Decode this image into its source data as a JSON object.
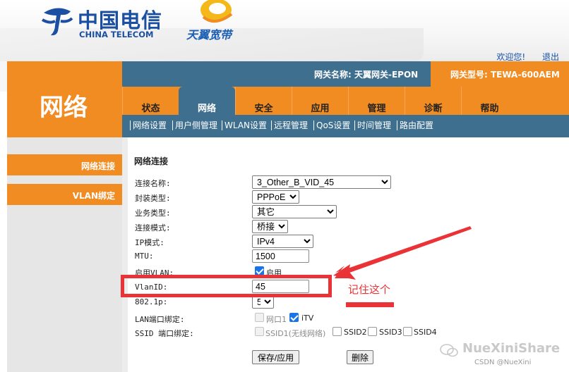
{
  "brand": {
    "logo_cn": "中国电信",
    "logo_en": "CHINA TELECOM",
    "tianyi": "天翼宽带",
    "colors": {
      "orange": "#f08c22",
      "steel_blue": "#3e6f8e",
      "logo_blue": "#1b4fa2",
      "annotation_red": "#ea3336"
    }
  },
  "top_links": {
    "welcome": "欢迎您!",
    "logout": "退出"
  },
  "section_title": "网络",
  "info_bar": {
    "gateway_name": "网关名称: 天翼网关-EPON",
    "gateway_model": "网关型号: TEWA-600AEM"
  },
  "tabs": [
    {
      "label": "状态"
    },
    {
      "label": "网络",
      "active": true
    },
    {
      "label": "安全"
    },
    {
      "label": "应用"
    },
    {
      "label": "管理"
    },
    {
      "label": "诊断"
    },
    {
      "label": "帮助"
    }
  ],
  "subnav": [
    "网络设置",
    "用户侧管理",
    "WLAN设置",
    "远程管理",
    "QoS设置",
    "时间管理",
    "路由配置"
  ],
  "sidebar": [
    {
      "label": "网络连接"
    },
    {
      "label": "VLAN绑定"
    }
  ],
  "form": {
    "title": "网络连接",
    "fields": {
      "conn_name": {
        "label": "连接名称:",
        "value": "3_Other_B_VID_45"
      },
      "encap": {
        "label": "封装类型:",
        "value": "PPPoE"
      },
      "service": {
        "label": "业务类型:",
        "value": "其它"
      },
      "conn_mode": {
        "label": "连接模式:",
        "value": "桥接"
      },
      "ip_mode": {
        "label": "IP模式:",
        "value": "IPv4"
      },
      "mtu": {
        "label": "MTU:",
        "value": "1500"
      },
      "vlan_enable": {
        "label": "启用VLAN:",
        "option": "启用",
        "checked": true
      },
      "vlan_id": {
        "label": "VlanID:",
        "value": "45"
      },
      "p8021": {
        "label": "802.1p:",
        "value": "5"
      },
      "lan_bind": {
        "label": "LAN端口绑定:",
        "options": [
          {
            "text": "网口1",
            "checked": false
          },
          {
            "text": "iTV",
            "checked": true
          }
        ]
      },
      "ssid_bind": {
        "label": "SSID 端口绑定:",
        "options": [
          {
            "text": "SSID1(无线网络)"
          },
          {
            "text": "SSID2"
          },
          {
            "text": "SSID3"
          },
          {
            "text": "SSID4"
          }
        ]
      }
    },
    "buttons": {
      "save": "保存/应用",
      "delete": "删除"
    }
  },
  "annotation": {
    "text": "记住这个"
  },
  "watermark": {
    "wechat": "NueXiniShare",
    "csdn": "CSDN @NueXini"
  }
}
